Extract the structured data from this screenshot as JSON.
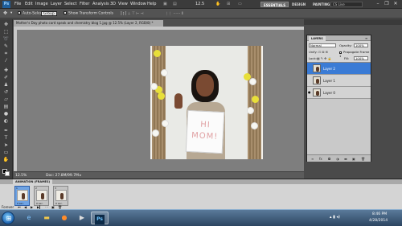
{
  "app": {
    "logo": "Ps"
  },
  "menu": {
    "items": [
      "File",
      "Edit",
      "Image",
      "Layer",
      "Select",
      "Filter",
      "Analysis",
      "3D",
      "View",
      "Window",
      "Help"
    ],
    "zoom_readout": "12.5",
    "workspaces": [
      "ESSENTIALS",
      "DESIGN",
      "PAINTING"
    ],
    "search_placeholder": "CS Live"
  },
  "options": {
    "auto_select_label": "Auto-Select:",
    "auto_select_value": "Group",
    "show_transform_label": "Show Transform Controls"
  },
  "document": {
    "tab_title": "Mother's Day photo card speak and chemistry blog 1.jpg @ 12.5% (Layer 2, RGB/8) *",
    "zoom": "12.5%",
    "doc_info": "Doc: 27.8M/99.7M",
    "sign_text": "HI\nMOM!"
  },
  "layers_panel": {
    "tab": "LAYERS",
    "blend_mode": "Normal",
    "opacity_label": "Opacity:",
    "opacity_value": "100%",
    "unify_label": "Unify:",
    "propagate_label": "Propagate Frame 1",
    "lock_label": "Lock:",
    "fill_label": "Fill:",
    "fill_value": "100%",
    "layers": [
      {
        "name": "Layer 2",
        "selected": true,
        "visible": false
      },
      {
        "name": "Layer 1",
        "selected": false,
        "visible": false
      },
      {
        "name": "Layer 0",
        "selected": false,
        "visible": true
      }
    ]
  },
  "animation_panel": {
    "tab": "ANIMATION (FRAMES)",
    "frames": [
      {
        "number": "1",
        "delay": "0 sec.",
        "selected": true
      },
      {
        "number": "2",
        "delay": "0 sec.",
        "selected": false
      },
      {
        "number": "3",
        "delay": "0 sec.",
        "selected": false
      }
    ],
    "loop_value": "Forever"
  },
  "taskbar": {
    "ps_label": "Ps",
    "time": "8:46 PM",
    "date": "4/28/2014"
  },
  "colors": {
    "selection_blue": "#3a7bd5",
    "ps_blue": "#1f5e9a"
  }
}
